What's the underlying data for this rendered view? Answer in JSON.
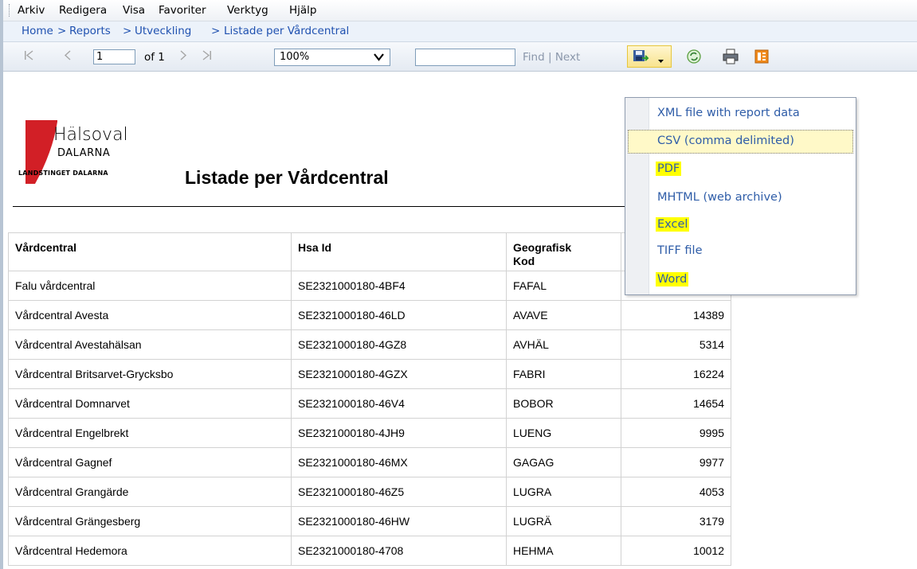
{
  "menu": [
    "Arkiv",
    "Redigera",
    "Visa",
    "Favoriter",
    "Verktyg",
    "Hjälp"
  ],
  "breadcrumb": [
    "Home",
    "Reports",
    "Utveckling",
    "Listade per Vårdcentral"
  ],
  "breadcrumb_sep": ">",
  "toolbar": {
    "page_value": "1",
    "of_label": "of 1",
    "zoom_value": "100%",
    "find_placeholder": "",
    "find_label": "Find",
    "find_sep": "|",
    "next_label": "Next"
  },
  "export_menu": {
    "items": [
      {
        "label": "XML file with report data",
        "highlighted": false
      },
      {
        "label": "CSV (comma delimited)",
        "highlighted": false,
        "selected": true
      },
      {
        "label": "PDF",
        "highlighted": true
      },
      {
        "label": "MHTML (web archive)",
        "highlighted": false
      },
      {
        "label": "Excel",
        "highlighted": true
      },
      {
        "label": "TIFF file",
        "highlighted": false
      },
      {
        "label": "Word",
        "highlighted": true
      }
    ]
  },
  "logo": {
    "line1": "Hälsoval",
    "line2": "DALARNA",
    "line3": "LANDSTINGET DALARNA",
    "color": "#d21f26"
  },
  "report": {
    "title": "Listade per Vårdcentral",
    "columns": [
      "Vårdcentral",
      "Hsa Id",
      "Geografisk\nKod",
      ""
    ],
    "rows": [
      [
        "Falu vårdcentral",
        "SE2321000180-4BF4",
        "FAFAL",
        ""
      ],
      [
        "Vårdcentral Avesta",
        "SE2321000180-46LD",
        "AVAVE",
        "14389"
      ],
      [
        "Vårdcentral Avestahälsan",
        "SE2321000180-4GZ8",
        "AVHÄL",
        "5314"
      ],
      [
        "Vårdcentral Britsarvet-Grycksbo",
        "SE2321000180-4GZX",
        "FABRI",
        "16224"
      ],
      [
        "Vårdcentral Domnarvet",
        "SE2321000180-46V4",
        "BOBOR",
        "14654"
      ],
      [
        "Vårdcentral Engelbrekt",
        "SE2321000180-4JH9",
        "LUENG",
        "9995"
      ],
      [
        "Vårdcentral Gagnef",
        "SE2321000180-46MX",
        "GAGAG",
        "9977"
      ],
      [
        "Vårdcentral Grangärde",
        "SE2321000180-46Z5",
        "LUGRA",
        "4053"
      ],
      [
        "Vårdcentral Grängesberg",
        "SE2321000180-46HW",
        "LUGRÄ",
        "3179"
      ],
      [
        "Vårdcentral Hedemora",
        "SE2321000180-4708",
        "HEHMA",
        "10012"
      ]
    ]
  },
  "colors": {
    "link": "#1f51b0",
    "highlight": "#ffff00",
    "menu_text": "#2f5da8"
  }
}
